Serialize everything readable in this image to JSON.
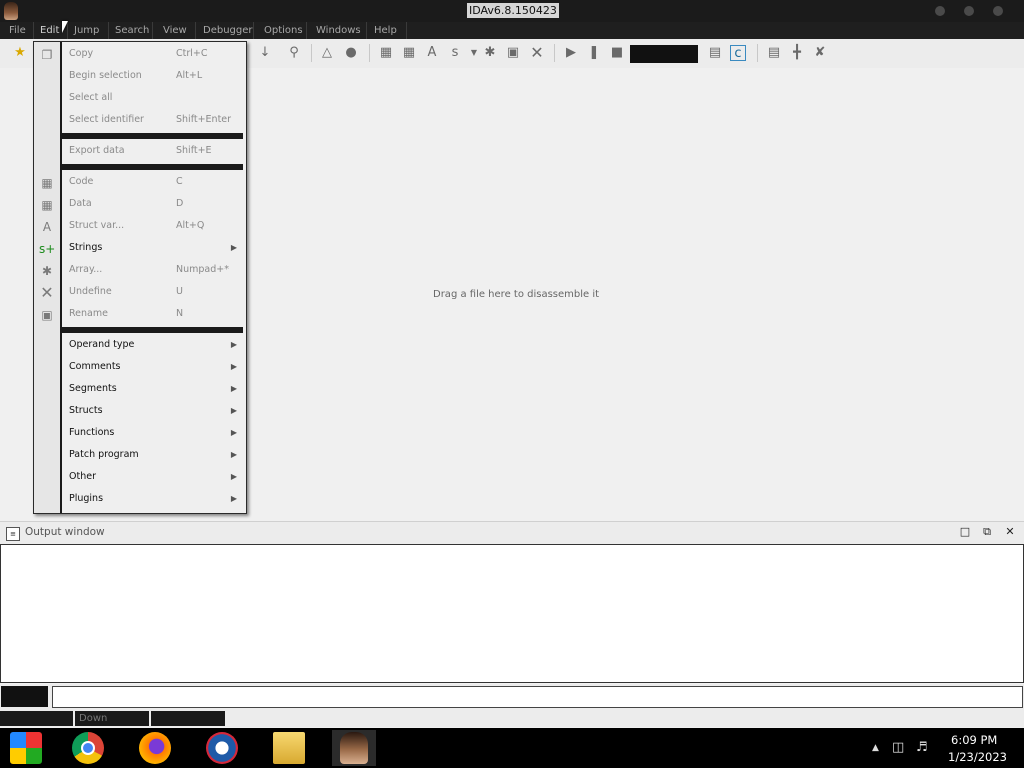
{
  "window": {
    "title": "IDAv6.8.150423"
  },
  "menubar": {
    "items": [
      "File",
      "Edit",
      "Jump",
      "Search",
      "View",
      "Debugger",
      "Options",
      "Windows",
      "Help"
    ]
  },
  "edit_menu": {
    "copy": {
      "label": "Copy",
      "shortcut": "Ctrl+C"
    },
    "begin_selection": {
      "label": "Begin selection",
      "shortcut": "Alt+L"
    },
    "select_all": {
      "label": "Select all"
    },
    "select_identifier": {
      "label": "Select identifier",
      "shortcut": "Shift+Enter"
    },
    "export_data": {
      "label": "Export data",
      "shortcut": "Shift+E"
    },
    "code": {
      "label": "Code",
      "shortcut": "C"
    },
    "data": {
      "label": "Data",
      "shortcut": "D"
    },
    "struct_var": {
      "label": "Struct var...",
      "shortcut": "Alt+Q"
    },
    "strings": {
      "label": "Strings"
    },
    "array": {
      "label": "Array...",
      "shortcut": "Numpad+*"
    },
    "undefine": {
      "label": "Undefine",
      "shortcut": "U"
    },
    "rename": {
      "label": "Rename",
      "shortcut": "N"
    },
    "operand_type": {
      "label": "Operand type"
    },
    "comments": {
      "label": "Comments"
    },
    "segments": {
      "label": "Segments"
    },
    "structs": {
      "label": "Structs"
    },
    "functions": {
      "label": "Functions"
    },
    "patch_program": {
      "label": "Patch program"
    },
    "other": {
      "label": "Other"
    },
    "plugins": {
      "label": "Plugins"
    }
  },
  "main": {
    "hint": "Drag a file here to disassemble it"
  },
  "output": {
    "title": "Output window"
  },
  "status": {
    "state": "Down"
  },
  "taskbar": {
    "time": "6:09 PM",
    "date": "1/23/2023"
  },
  "colors": {
    "menubar_bg": "#1f1f1f",
    "taskbar_bg": "#000000",
    "menu_bg": "#efefef"
  }
}
